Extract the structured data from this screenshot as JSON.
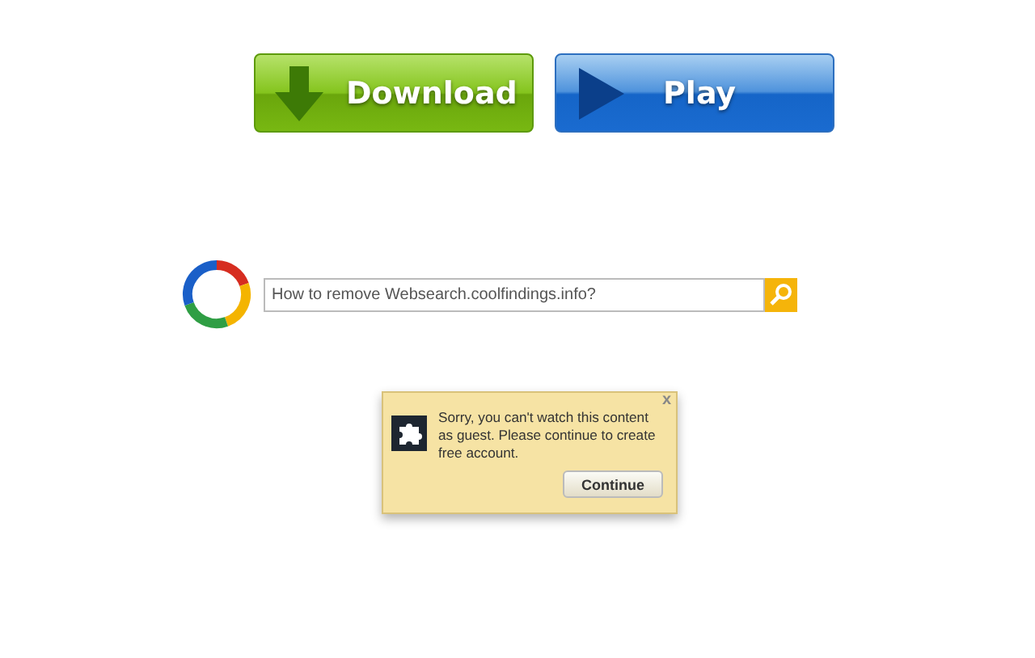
{
  "buttons": [
    {
      "kind": "download",
      "label": "Download"
    },
    {
      "kind": "play",
      "label": "Play"
    }
  ],
  "search": {
    "value": "How to remove Websearch.coolfindings.info?"
  },
  "popup": {
    "close": "x",
    "message": "Sorry, you can't watch this content as guest. Please continue to create free account.",
    "button": "Continue"
  }
}
